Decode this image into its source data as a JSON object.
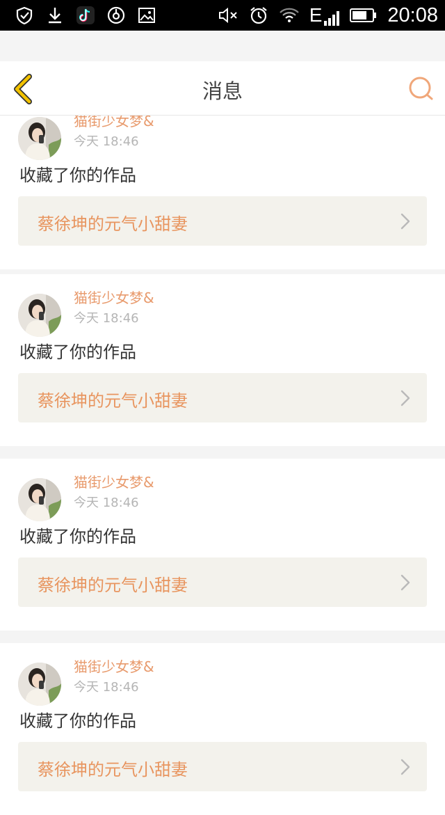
{
  "status_bar": {
    "left_icons": [
      "shield-check-icon",
      "download-icon",
      "tiktok-icon",
      "music-app-icon",
      "image-icon"
    ],
    "right_icons": [
      "mute-icon",
      "alarm-icon",
      "wifi-icon",
      "signal-icon",
      "battery-icon"
    ],
    "network": "E",
    "time": "20:08"
  },
  "header": {
    "title": "消息"
  },
  "colors": {
    "accent": "#e8955f",
    "back_icon": "#f0b400",
    "card_link_bg": "#f3f2ec"
  },
  "messages": [
    {
      "user": "猫街少女梦&",
      "time": "今天 18:46",
      "action": "收藏了你的作品",
      "work": "蔡徐坤的元气小甜妻"
    },
    {
      "user": "猫街少女梦&",
      "time": "今天 18:46",
      "action": "收藏了你的作品",
      "work": "蔡徐坤的元气小甜妻"
    },
    {
      "user": "猫街少女梦&",
      "time": "今天 18:46",
      "action": "收藏了你的作品",
      "work": "蔡徐坤的元气小甜妻"
    },
    {
      "user": "猫街少女梦&",
      "time": "今天 18:46",
      "action": "收藏了你的作品",
      "work": "蔡徐坤的元气小甜妻"
    }
  ]
}
